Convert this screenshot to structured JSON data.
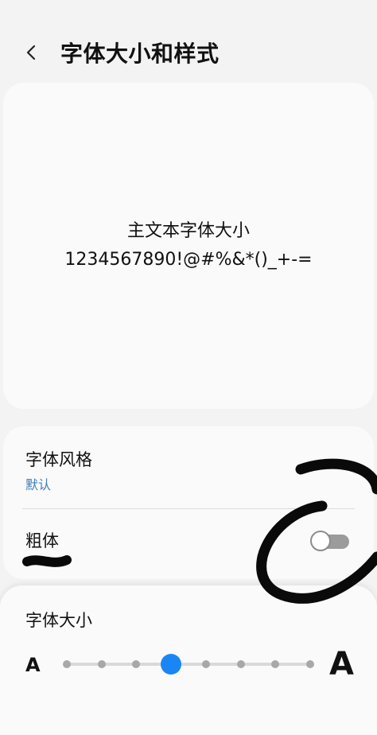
{
  "header": {
    "back_icon": "chevron-left-icon",
    "title": "字体大小和样式"
  },
  "preview": {
    "line1": "主文本字体大小",
    "line2": "1234567890!@#%&*()_+-="
  },
  "font_style": {
    "label": "字体风格",
    "value": "默认"
  },
  "bold": {
    "label": "粗体",
    "enabled": false
  },
  "font_size": {
    "title": "字体大小",
    "small_glyph": "A",
    "large_glyph": "A",
    "steps": 8,
    "selected_step": 4
  },
  "colors": {
    "accent": "#1a86f5",
    "link": "#3a7fb8",
    "background": "#f3f3f3",
    "card": "#fafafa"
  }
}
